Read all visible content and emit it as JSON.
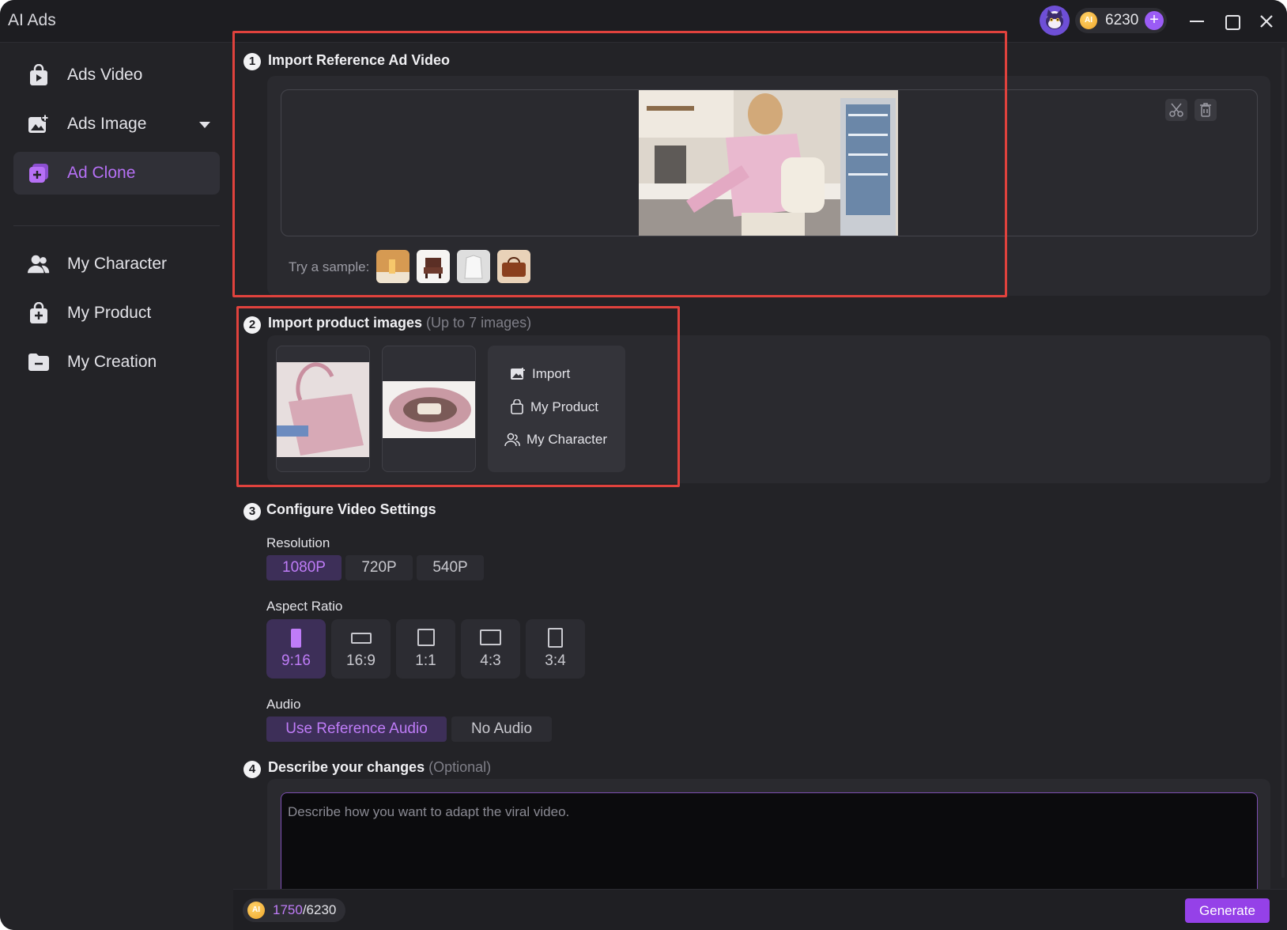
{
  "app": {
    "title": "AI Ads",
    "credits": "6230",
    "coin_label": "AI"
  },
  "sidebar": {
    "items": [
      {
        "label": "Ads Video",
        "icon": "video-bag-icon"
      },
      {
        "label": "Ads Image",
        "icon": "image-add-icon"
      },
      {
        "label": "Ad Clone",
        "icon": "clone-icon",
        "active": true
      },
      {
        "label": "My Character",
        "icon": "users-icon"
      },
      {
        "label": "My Product",
        "icon": "bag-icon"
      },
      {
        "label": "My Creation",
        "icon": "folder-icon"
      }
    ]
  },
  "steps": {
    "s1": {
      "num": "1",
      "title": "Import Reference Ad Video",
      "sample_label": "Try a sample:"
    },
    "s2": {
      "num": "2",
      "title": "Import product images",
      "hint": "(Up to 7 images)",
      "options": {
        "import": "Import",
        "my_product": "My Product",
        "my_character": "My Character"
      }
    },
    "s3": {
      "num": "3",
      "title": "Configure Video Settings",
      "resolution_label": "Resolution",
      "resolutions": [
        "1080P",
        "720P",
        "540P"
      ],
      "aspect_label": "Aspect Ratio",
      "ratios": [
        "9:16",
        "16:9",
        "1:1",
        "4:3",
        "3:4"
      ],
      "audio_label": "Audio",
      "audio_options": [
        "Use Reference Audio",
        "No Audio"
      ]
    },
    "s4": {
      "num": "4",
      "title": "Describe your changes",
      "hint": "(Optional)",
      "placeholder": "Describe how you want to adapt the viral video."
    }
  },
  "footer": {
    "cost_used": "1750",
    "cost_total": "/6230",
    "generate": "Generate"
  },
  "colors": {
    "accent": "#9541e8",
    "accent_text": "#bf7cf8",
    "highlight": "#e0423d"
  }
}
